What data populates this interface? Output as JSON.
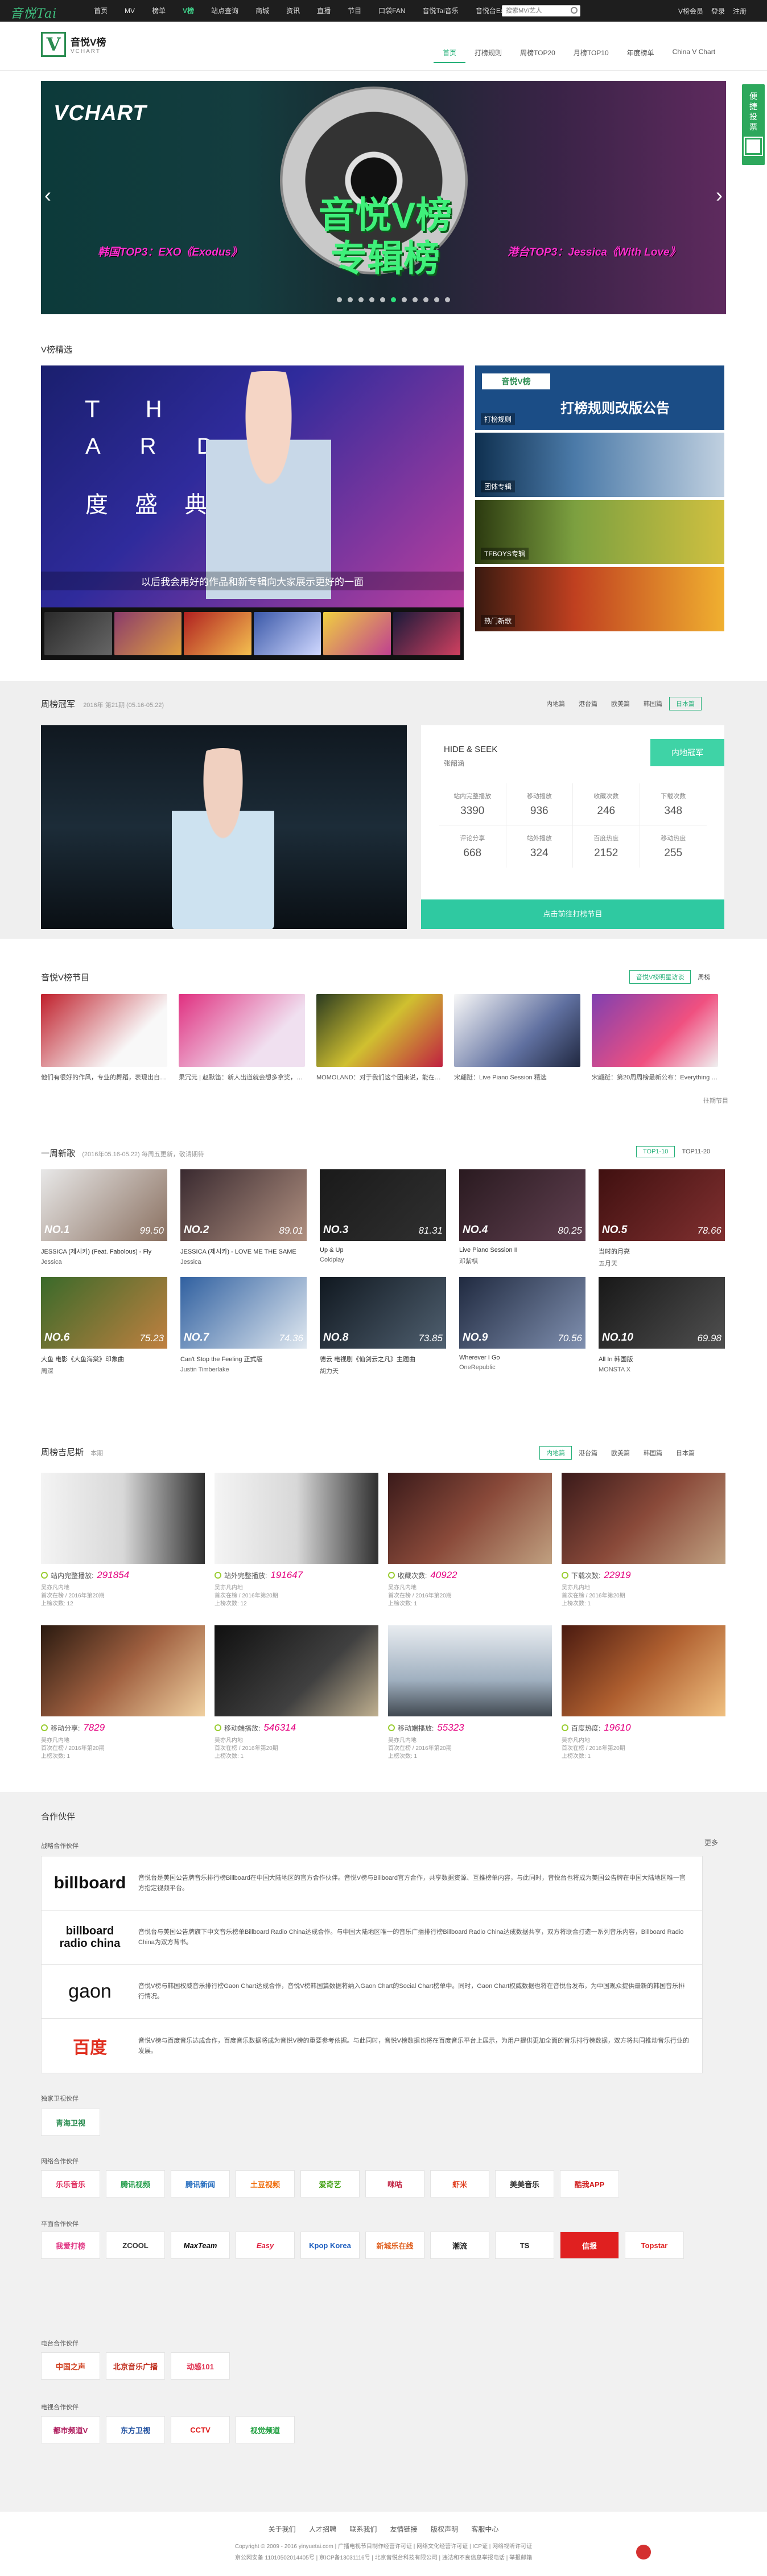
{
  "topbar": {
    "logo": "音悦Tai",
    "nav": [
      "首页",
      "MV",
      "榜单",
      "V榜",
      "站点查询",
      "商城",
      "资讯",
      "直播",
      "节目",
      "口袋FAN",
      "音悦Tai音乐",
      "音悦台Expo",
      "BBC"
    ],
    "search_placeholder": "搜索MV/艺人",
    "right": [
      "V榜会员",
      "登录",
      "注册"
    ]
  },
  "header": {
    "brand_title": "音悦V榜",
    "brand_sub": "VCHART",
    "menu": [
      "首页",
      "打榜规则",
      "周榜TOP20",
      "月榜TOP10",
      "年度榜单",
      "China V Chart"
    ]
  },
  "sidefloat": {
    "label": "便捷投票"
  },
  "banner": {
    "vchart": "VCHART",
    "big1": "音悦V榜",
    "big2": "专辑榜",
    "caption_left": "韩国TOP3：EXO《Exodus》",
    "caption_right": "港台TOP3：Jessica《With Love》"
  },
  "vjx": {
    "title": "V榜精选",
    "main_letters1": "T H",
    "main_letters2": "A R D",
    "main_cn": "度 盛 典",
    "main_caption": "以后我会用好的作品和新专辑向大家展示更好的一面",
    "card1_title": "打榜规则改版公告",
    "card1_badge": "音悦V榜",
    "card1_label": "打榜规则",
    "card2_label": "团体专辑",
    "card3_label": "TFBOYS专辑",
    "card4_label": "热门新歌"
  },
  "weekly": {
    "title": "周榜冠军",
    "date": "2016年 第21期 (05.16-05.22)",
    "tabs": [
      "内地篇",
      "港台篇",
      "欧美篇",
      "韩国篇",
      "日本篇"
    ],
    "song": "HIDE & SEEK",
    "artist": "张韶涵",
    "badge": "内地冠军",
    "stats": [
      {
        "label": "站内完整播放",
        "value": "3390"
      },
      {
        "label": "移动播放",
        "value": "936"
      },
      {
        "label": "收藏次数",
        "value": "246"
      },
      {
        "label": "下载次数",
        "value": "348"
      },
      {
        "label": "评论分享",
        "value": "668"
      },
      {
        "label": "站外播放",
        "value": "324"
      },
      {
        "label": "百度热度",
        "value": "2152"
      },
      {
        "label": "移动热度",
        "value": "255"
      }
    ],
    "vote_button": "点击前往打榜节目"
  },
  "show": {
    "title": "音悦V榜节目",
    "tabs": [
      "音悦V榜明星访谈",
      "周榜"
    ],
    "more": "往期节目",
    "items": [
      {
        "caption": "他们有很好的作风，专业的舞蹈，表现出自己的风格，我也想和他们合作一次"
      },
      {
        "caption": "果冗元 | 赵默笛：新人出道就会想多拿奖，但总觉得不太真实"
      },
      {
        "caption": "MOMOLAND：对于我们这个团来说，能在中国发展是最大的荣幸"
      },
      {
        "caption": "宋翩跹：Live Piano Session 精选"
      },
      {
        "caption": "宋翩跹：第20周周榜最新公布：Everything is going up!"
      }
    ]
  },
  "newsongs": {
    "title": "一周新歌",
    "sub": "(2016年05.16-05.22)  每周五更新，敬请期待",
    "tabs": [
      "TOP1-10",
      "TOP11-20"
    ],
    "tiles": [
      {
        "no": "NO.1",
        "score": "99.50",
        "title": "JESSICA (제시카) (Feat. Fabolous) - Fly",
        "artist": "Jessica"
      },
      {
        "no": "NO.2",
        "score": "89.01",
        "title": "JESSICA (제시카) - LOVE ME THE SAME",
        "artist": "Jessica"
      },
      {
        "no": "NO.3",
        "score": "81.31",
        "title": "Up & Up",
        "artist": "Coldplay"
      },
      {
        "no": "NO.4",
        "score": "80.25",
        "title": "Live Piano Session II",
        "artist": "邓紫棋"
      },
      {
        "no": "NO.5",
        "score": "78.66",
        "title": "当时的月亮",
        "artist": "五月天"
      },
      {
        "no": "NO.6",
        "score": "75.23",
        "title": "大鱼 电影《大鱼海棠》印象曲",
        "artist": "周深"
      },
      {
        "no": "NO.7",
        "score": "74.36",
        "title": "Can't Stop the Feeling 正式版",
        "artist": "Justin Timberlake"
      },
      {
        "no": "NO.8",
        "score": "73.85",
        "title": "德云 电视剧《仙剑云之凡》主题曲",
        "artist": "胡力天"
      },
      {
        "no": "NO.9",
        "score": "70.56",
        "title": "Wherever I Go",
        "artist": "OneRepublic"
      },
      {
        "no": "NO.10",
        "score": "69.98",
        "title": "All In 韩国版",
        "artist": "MONSTA X"
      }
    ]
  },
  "guin": {
    "title": "周榜吉尼斯",
    "sub": "本期",
    "tabs": [
      "内地篇",
      "港台篇",
      "欧美篇",
      "韩国篇",
      "日本篇"
    ],
    "tiles": [
      {
        "label": "站内完整播放:",
        "value": "291854",
        "line1": "吴亦凡内地",
        "line2": "首次在榜 / 2016年第20期",
        "line3": "上榜次数: 12"
      },
      {
        "label": "站外完整播放:",
        "value": "191647",
        "line1": "吴亦凡内地",
        "line2": "首次在榜 / 2016年第20期",
        "line3": "上榜次数: 12"
      },
      {
        "label": "收藏次数:",
        "value": "40922",
        "line1": "吴亦凡内地",
        "line2": "首次在榜 / 2016年第20期",
        "line3": "上榜次数: 1"
      },
      {
        "label": "下载次数:",
        "value": "22919",
        "line1": "吴亦凡内地",
        "line2": "首次在榜 / 2016年第20期",
        "line3": "上榜次数: 1"
      },
      {
        "label": "移动分享:",
        "value": "7829",
        "line1": "吴亦凡内地",
        "line2": "首次在榜 / 2016年第20期",
        "line3": "上榜次数: 1"
      },
      {
        "label": "移动端播放:",
        "value": "546314",
        "line1": "吴亦凡内地",
        "line2": "首次在榜 / 2016年第20期",
        "line3": "上榜次数: 1"
      },
      {
        "label": "移动端播放:",
        "value": "55323",
        "line1": "吴亦凡内地",
        "line2": "首次在榜 / 2016年第20期",
        "line3": "上榜次数: 1"
      },
      {
        "label": "百度热度:",
        "value": "19610",
        "line1": "吴亦凡内地",
        "line2": "首次在榜 / 2016年第20期",
        "line3": "上榜次数: 1"
      }
    ]
  },
  "partners": {
    "title": "合作伙伴",
    "more": "更多",
    "cat_chart": "战略合作伙伴",
    "charts": [
      {
        "logo": "billboard",
        "desc": "音悦台是美国公告牌音乐排行榜Billboard在中国大陆地区的官方合作伙伴。音悦V榜与Billboard官方合作，共享数据资源、互推榜单内容，与此同时，音悦台也将成为美国公告牌在中国大陆地区唯一官方指定视频平台。"
      },
      {
        "logo": "billboard radio china",
        "desc": "音悦台与美国公告牌旗下中文音乐榜单Billboard Radio China达成合作。与中国大陆地区唯一的音乐广播排行榜Billboard Radio China达成数据共享，双方将联合打造一系列音乐内容，Billboard Radio China为双方背书。"
      },
      {
        "logo": "gaon",
        "desc": "音悦V榜与韩国权威音乐排行榜Gaon Chart达成合作，音悦V榜韩国篇数据将纳入Gaon Chart的Social Chart榜单中。同时，Gaon Chart权威数据也将在音悦台发布，为中国观众提供最新的韩国音乐排行情况。"
      },
      {
        "logo": "百度",
        "desc": "音悦V榜与百度音乐达成合作，百度音乐数据将成为音悦V榜的重要参考依据。与此同时，音悦V榜数据也将在百度音乐平台上展示，为用户提供更加全面的音乐排行榜数据，双方将共同推动音乐行业的发展。"
      }
    ],
    "cat_tv": "独家卫视伙伴",
    "tv": [
      "青海卫视"
    ],
    "cat_web": "网络合作伙伴",
    "web": [
      "乐乐音乐",
      "腾讯视频",
      "腾讯新闻",
      "土豆视频",
      "爱奇艺",
      "咪咕",
      "虾米",
      "美美音乐",
      "酷我APP"
    ],
    "cat_print": "平面合作伙伴",
    "print": [
      "我爱打榜",
      "ZCOOL",
      "MaxTeam",
      "Easy",
      "Kpop Korea",
      "新城乐在线",
      "潮流",
      "TS",
      "信报",
      "Topstar"
    ],
    "cat_radio": "电台合作伙伴",
    "radio": [
      "中国之声",
      "北京音乐广播",
      "动感101"
    ],
    "cat_tvmedia": "电视合作伙伴",
    "tvmedia": [
      "都市频道V",
      "东方卫视",
      "CCTV",
      "视觉频道"
    ]
  },
  "footer": {
    "links": [
      "关于我们",
      "人才招聘",
      "联系我们",
      "友情链接",
      "版权声明",
      "客服中心"
    ],
    "line1": "Copyright © 2009 - 2016 yinyuetai.com | 广播电视节目制作经营许可证 | 网络文化经营许可证 | ICP证 | 网络视听许可证",
    "line2": "京公网安备 11010502014405号 | 京ICP备13031116号 | 北京音悦台科技有限公司 | 违法和不良信息举报电话 | 举报邮箱"
  }
}
